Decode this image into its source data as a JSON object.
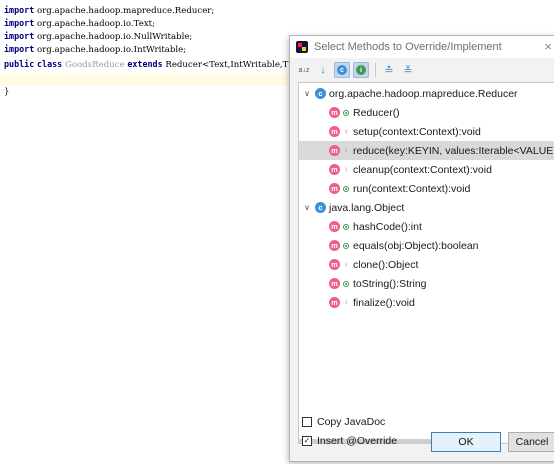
{
  "editor": {
    "lines": [
      {
        "kw": "import",
        "rest": " org.apache.hadoop.mapreduce.Reducer;"
      },
      {
        "kw": "import",
        "rest": " org.apache.hadoop.io.Text;"
      },
      {
        "kw": "import",
        "rest": " org.apache.hadoop.io.NullWritable;"
      },
      {
        "kw": "import",
        "rest": " org.apache.hadoop.io.IntWritable;"
      }
    ],
    "class_line": {
      "kw1": "public",
      "kw2": "class",
      "name": "GoodsReduce",
      "kw3": "extends",
      "rest": "Reducer<Text,IntWritable,T"
    },
    "closing_brace": "}"
  },
  "dialog": {
    "title": "Select Methods to Override/Implement",
    "close": "×",
    "toolbar": {
      "sort_alpha": "a↓z",
      "sort_vis": "↓",
      "class_btn": "c",
      "interface_btn": "i",
      "expand_all": "≛",
      "collapse_all": "≚"
    },
    "tree": {
      "groups": [
        {
          "arrow": "∨",
          "name": "org.apache.hadoop.mapreduce.Reducer",
          "methods": [
            {
              "label": "Reducer()",
              "vis": "public"
            },
            {
              "label": "setup(context:Context):void",
              "vis": "protected"
            },
            {
              "label": "reduce(key:KEYIN, values:Iterable<VALUEIN>, c",
              "vis": "protected",
              "selected": true
            },
            {
              "label": "cleanup(context:Context):void",
              "vis": "protected"
            },
            {
              "label": "run(context:Context):void",
              "vis": "public"
            }
          ]
        },
        {
          "arrow": "∨",
          "name": "java.lang.Object",
          "methods": [
            {
              "label": "hashCode():int",
              "vis": "public"
            },
            {
              "label": "equals(obj:Object):boolean",
              "vis": "public"
            },
            {
              "label": "clone():Object",
              "vis": "protected"
            },
            {
              "label": "toString():String",
              "vis": "public"
            },
            {
              "label": "finalize():void",
              "vis": "protected"
            }
          ]
        }
      ]
    },
    "copy_javadoc": {
      "label": "Copy JavaDoc",
      "checked": false
    },
    "insert_override": {
      "label": "Insert @Override",
      "checked": true,
      "mark": "✓"
    },
    "ok_label": "OK",
    "cancel_label": "Cancel"
  }
}
